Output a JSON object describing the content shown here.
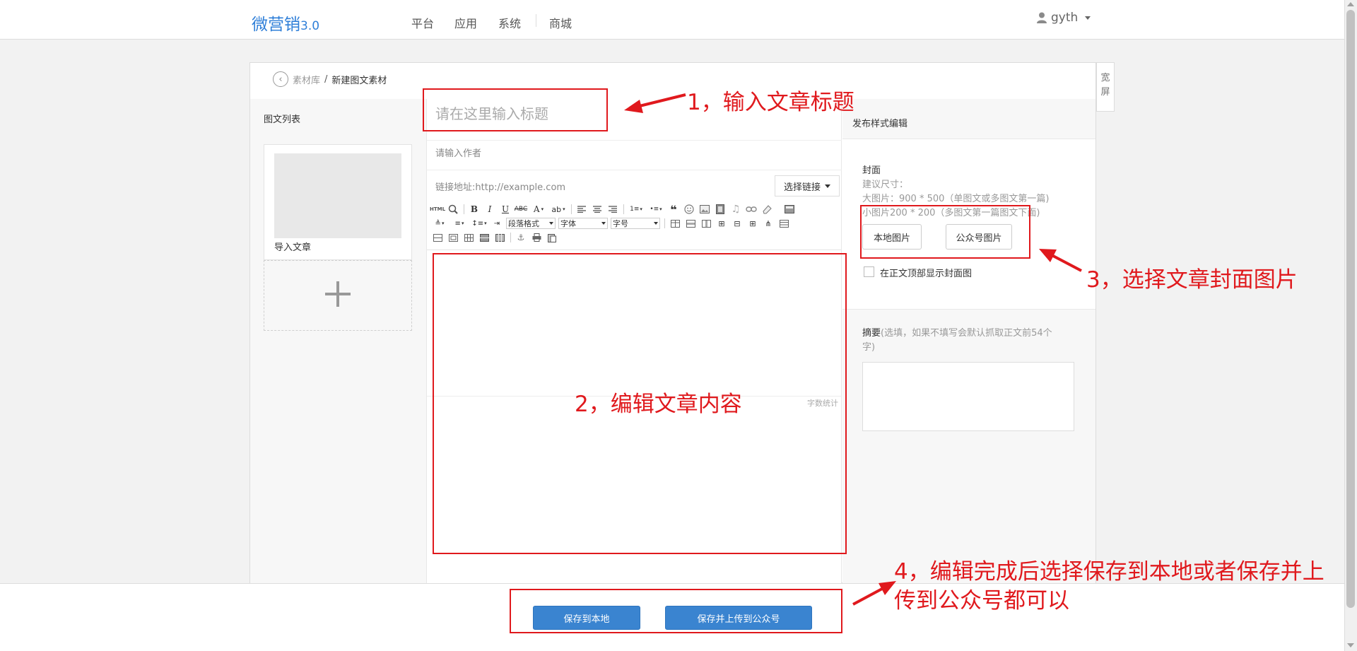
{
  "header": {
    "brand": "微营销",
    "brand_version": "3.0",
    "nav": [
      "平台",
      "应用",
      "系统",
      "商城"
    ],
    "username": "gyth"
  },
  "breadcrumb": {
    "parent": "素材库",
    "separator": "/",
    "current": "新建图文素材"
  },
  "fullscreen_label": "宽屏",
  "left_panel": {
    "title": "图文列表",
    "import_label": "导入文章"
  },
  "editor": {
    "title_placeholder": "请在这里输入标题",
    "author_placeholder": "请输入作者",
    "link_placeholder": "链接地址:http://example.com",
    "choose_link_label": "选择链接",
    "toolbar": {
      "html_label": "HTML",
      "paragraph_format": "段落格式",
      "font_family": "字体",
      "font_size": "字号"
    },
    "word_count_label": "字数统计"
  },
  "right_panel": {
    "title": "发布样式编辑",
    "cover_label": "封面",
    "size_hint": "建议尺寸：",
    "size_large": "大图片：900 * 500（单图文或多图文第一篇)",
    "size_small": "小图片200 * 200（多图文第一篇图文下面)",
    "local_image_button": "本地图片",
    "wechat_image_button": "公众号图片",
    "show_cover_label": "在正文顶部显示封面图",
    "summary_label": "摘要",
    "summary_hint": "(选填，如果不填写会默认抓取正文前54个字)"
  },
  "footer": {
    "save_local_button": "保存到本地",
    "save_upload_button": "保存并上传到公众号"
  },
  "annotations": {
    "step1": "1，输入文章标题",
    "step2": "2，编辑文章内容",
    "step3": "3，选择文章封面图片",
    "step4_line1": "4，编辑完成后选择保存到本地或者保存并上",
    "step4_line2": "传到公众号都可以"
  },
  "colors": {
    "brand": "#2f7fd8",
    "primary_button": "#3a84d0",
    "annotation_red": "#e0191d"
  }
}
